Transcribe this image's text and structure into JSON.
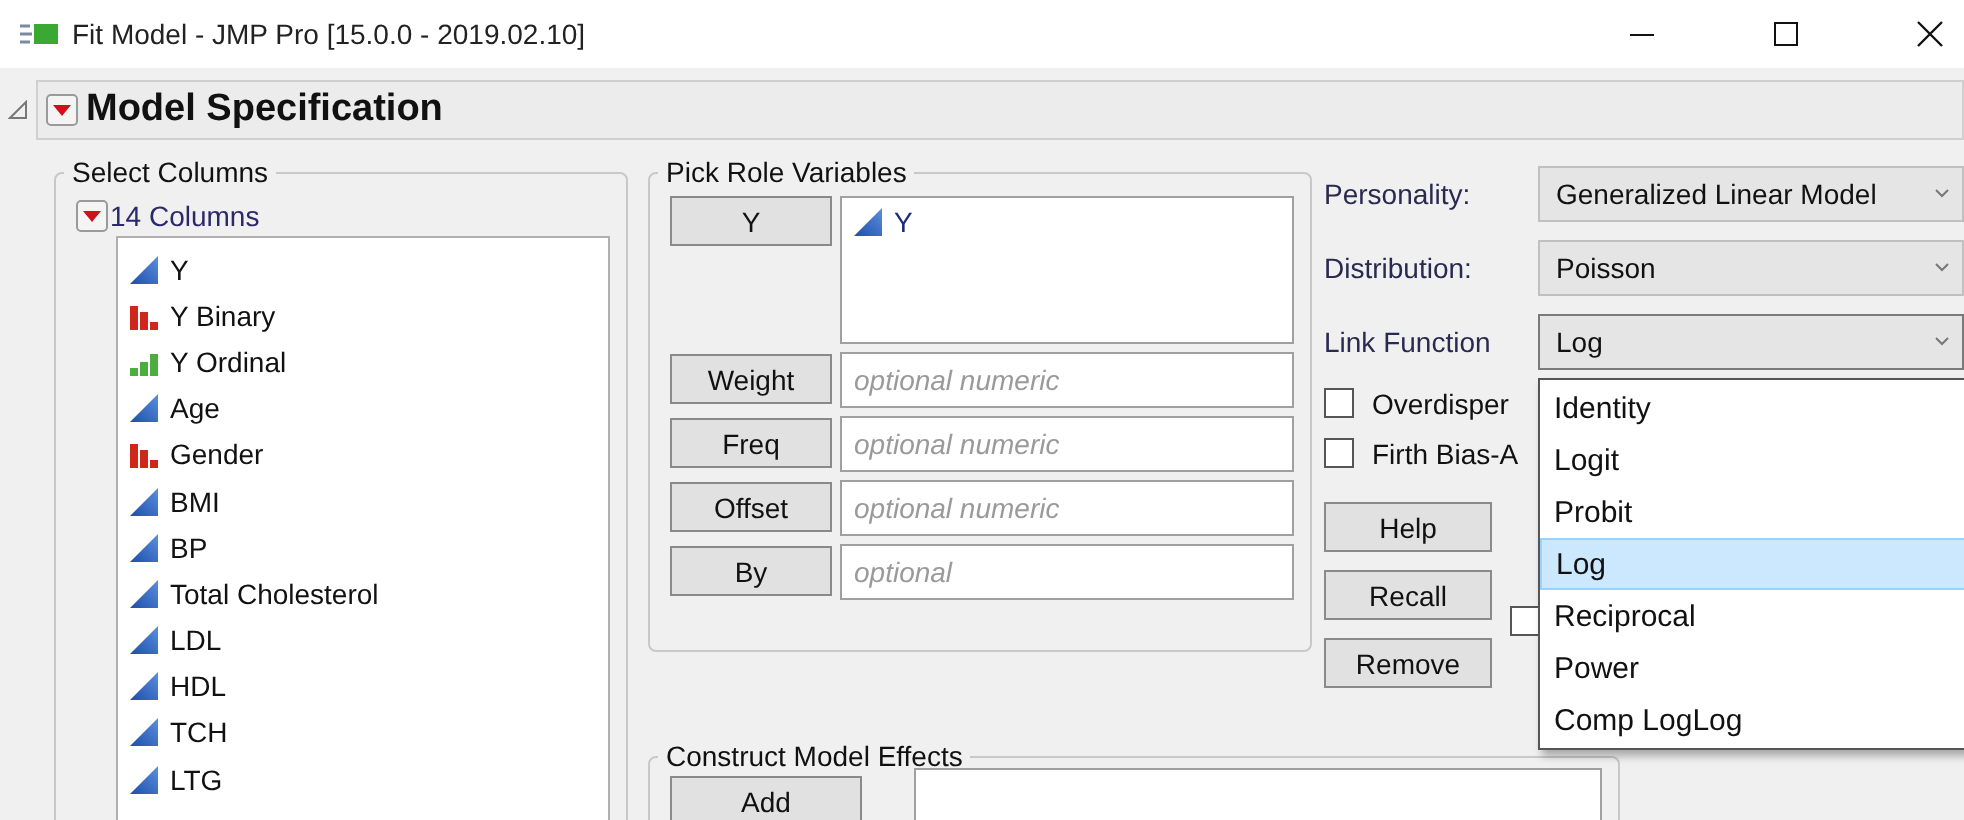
{
  "window": {
    "title": "Fit Model - JMP Pro [15.0.0 - 2019.02.10]"
  },
  "section": {
    "title": "Model Specification",
    "expanded": true
  },
  "select_columns": {
    "title": "Select Columns",
    "header": "14 Columns",
    "columns": [
      {
        "name": "Y",
        "kind": "continuous"
      },
      {
        "name": "Y Binary",
        "kind": "nominal"
      },
      {
        "name": "Y Ordinal",
        "kind": "ordinal"
      },
      {
        "name": "Age",
        "kind": "continuous"
      },
      {
        "name": "Gender",
        "kind": "nominal"
      },
      {
        "name": "BMI",
        "kind": "continuous"
      },
      {
        "name": "BP",
        "kind": "continuous"
      },
      {
        "name": "Total Cholesterol",
        "kind": "continuous"
      },
      {
        "name": "LDL",
        "kind": "continuous"
      },
      {
        "name": "HDL",
        "kind": "continuous"
      },
      {
        "name": "TCH",
        "kind": "continuous"
      },
      {
        "name": "LTG",
        "kind": "continuous"
      }
    ]
  },
  "pick_roles": {
    "title": "Pick Role Variables",
    "roles": [
      {
        "button": "Y",
        "values": [
          {
            "name": "Y",
            "kind": "continuous"
          }
        ]
      },
      {
        "button": "Weight",
        "placeholder": "optional numeric"
      },
      {
        "button": "Freq",
        "placeholder": "optional numeric"
      },
      {
        "button": "Offset",
        "placeholder": "optional numeric"
      },
      {
        "button": "By",
        "placeholder": "optional"
      }
    ]
  },
  "settings": [
    {
      "label": "Personality:",
      "value": "Generalized Linear Model",
      "expanded": false
    },
    {
      "label": "Distribution:",
      "value": "Poisson",
      "expanded": false
    },
    {
      "label": "Link Function",
      "value": "Log",
      "expanded": true,
      "options": [
        {
          "label": "Identity",
          "selected": false
        },
        {
          "label": "Logit",
          "selected": false
        },
        {
          "label": "Probit",
          "selected": false
        },
        {
          "label": "Log",
          "selected": true
        },
        {
          "label": "Reciprocal",
          "selected": false
        },
        {
          "label": "Power",
          "selected": false
        },
        {
          "label": "Comp LogLog",
          "selected": false
        }
      ]
    }
  ],
  "options": [
    {
      "label": "Overdisper",
      "checked": false
    },
    {
      "label": "Firth Bias-A",
      "checked": false
    }
  ],
  "buttons": [
    "Help",
    "Recall",
    "Remove"
  ],
  "extra_checkbox": {
    "checked": false
  },
  "construct": {
    "title": "Construct Model Effects",
    "buttons": [
      "Add"
    ]
  }
}
